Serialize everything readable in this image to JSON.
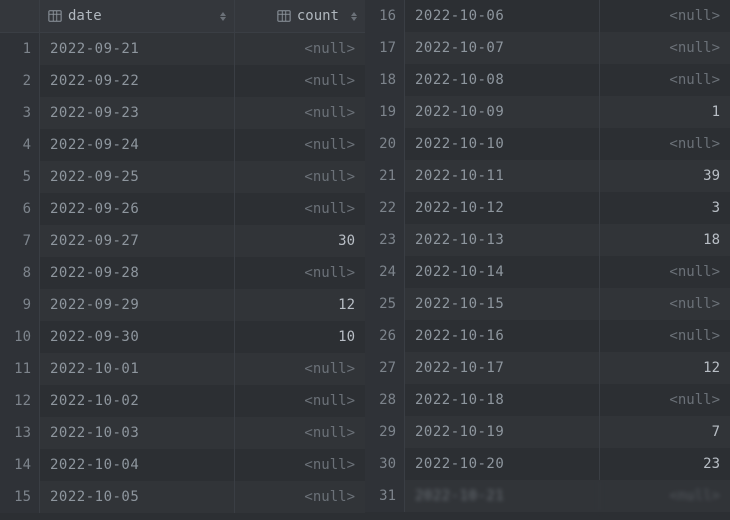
{
  "columns": {
    "date_label": "date",
    "count_label": "count"
  },
  "null_text": "null",
  "rows": [
    {
      "n": 1,
      "date": "2022-09-21",
      "count": null
    },
    {
      "n": 2,
      "date": "2022-09-22",
      "count": null
    },
    {
      "n": 3,
      "date": "2022-09-23",
      "count": null
    },
    {
      "n": 4,
      "date": "2022-09-24",
      "count": null
    },
    {
      "n": 5,
      "date": "2022-09-25",
      "count": null
    },
    {
      "n": 6,
      "date": "2022-09-26",
      "count": null
    },
    {
      "n": 7,
      "date": "2022-09-27",
      "count": 30
    },
    {
      "n": 8,
      "date": "2022-09-28",
      "count": null
    },
    {
      "n": 9,
      "date": "2022-09-29",
      "count": 12
    },
    {
      "n": 10,
      "date": "2022-09-30",
      "count": 10
    },
    {
      "n": 11,
      "date": "2022-10-01",
      "count": null
    },
    {
      "n": 12,
      "date": "2022-10-02",
      "count": null
    },
    {
      "n": 13,
      "date": "2022-10-03",
      "count": null
    },
    {
      "n": 14,
      "date": "2022-10-04",
      "count": null
    },
    {
      "n": 15,
      "date": "2022-10-05",
      "count": null
    },
    {
      "n": 16,
      "date": "2022-10-06",
      "count": null
    },
    {
      "n": 17,
      "date": "2022-10-07",
      "count": null
    },
    {
      "n": 18,
      "date": "2022-10-08",
      "count": null
    },
    {
      "n": 19,
      "date": "2022-10-09",
      "count": 1
    },
    {
      "n": 20,
      "date": "2022-10-10",
      "count": null
    },
    {
      "n": 21,
      "date": "2022-10-11",
      "count": 39
    },
    {
      "n": 22,
      "date": "2022-10-12",
      "count": 3
    },
    {
      "n": 23,
      "date": "2022-10-13",
      "count": 18
    },
    {
      "n": 24,
      "date": "2022-10-14",
      "count": null
    },
    {
      "n": 25,
      "date": "2022-10-15",
      "count": null
    },
    {
      "n": 26,
      "date": "2022-10-16",
      "count": null
    },
    {
      "n": 27,
      "date": "2022-10-17",
      "count": 12
    },
    {
      "n": 28,
      "date": "2022-10-18",
      "count": null
    },
    {
      "n": 29,
      "date": "2022-10-19",
      "count": 7
    },
    {
      "n": 30,
      "date": "2022-10-20",
      "count": 23
    },
    {
      "n": 31,
      "date": "2022-10-21",
      "count": null,
      "obscured": true
    }
  ]
}
